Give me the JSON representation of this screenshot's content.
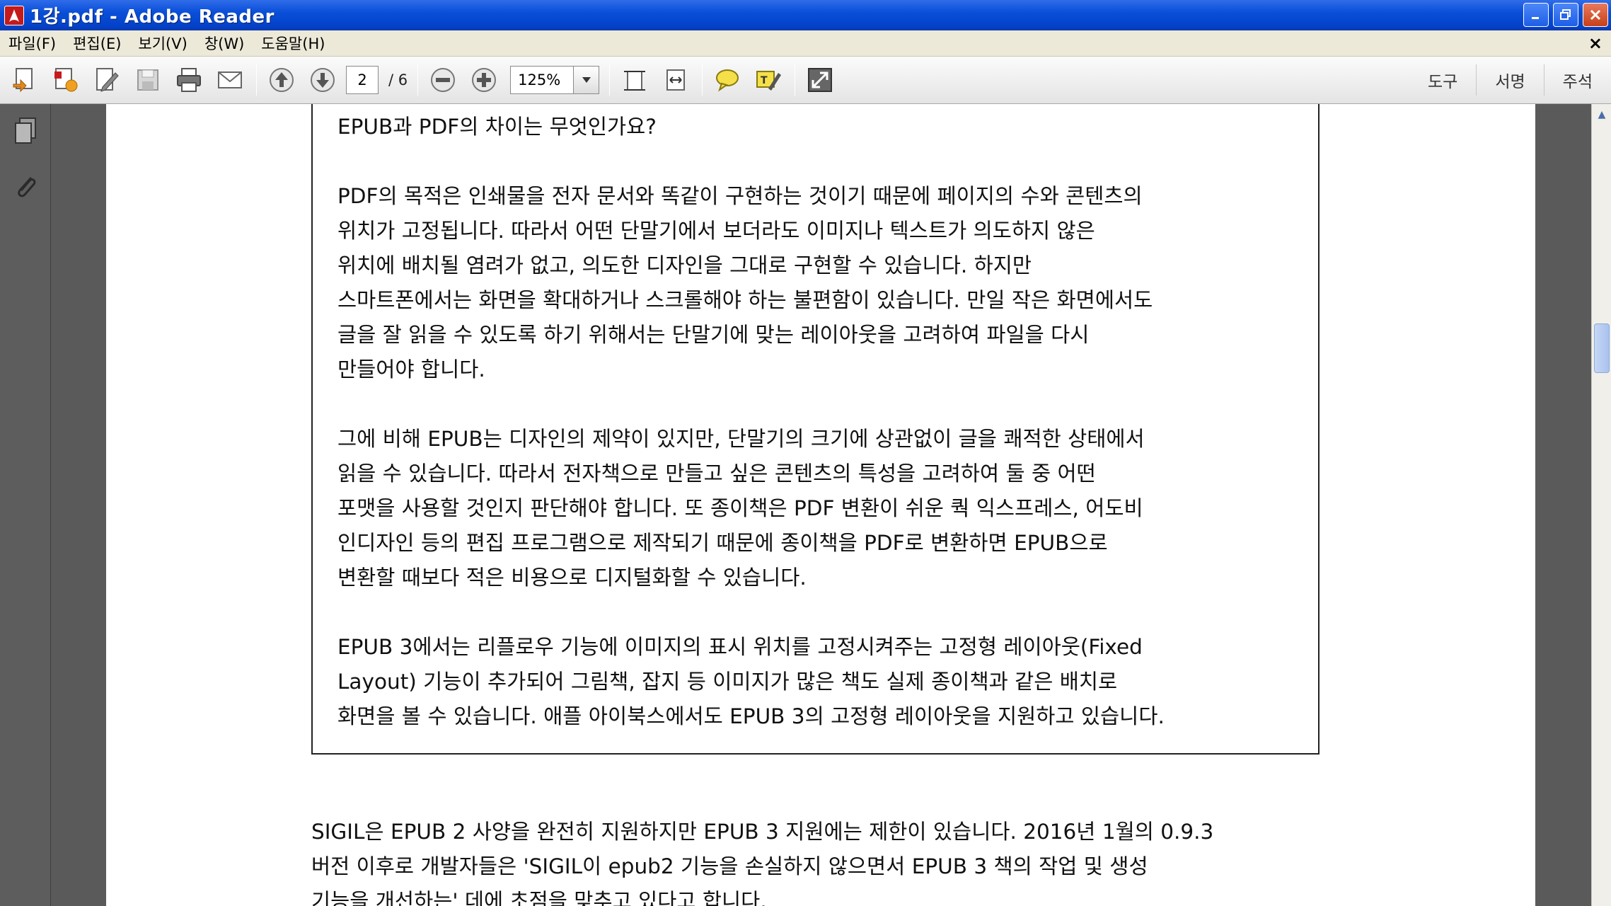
{
  "window": {
    "title": "1강.pdf - Adobe Reader",
    "app_icon_glyph": "★",
    "buttons": {
      "minimize": "_",
      "maximize": "□",
      "close": "×"
    }
  },
  "menu": {
    "items": [
      "파일(F)",
      "편집(E)",
      "보기(V)",
      "창(W)",
      "도움말(H)"
    ],
    "close_glyph": "×"
  },
  "toolbar": {
    "page_current": "2",
    "page_total": "/ 6",
    "zoom": "125%",
    "right_tools": [
      "도구",
      "서명",
      "주석"
    ]
  },
  "document": {
    "boxed_paragraphs": [
      [
        "EPUB과 PDF의 차이는 무엇인가요?"
      ],
      [
        "PDF의 목적은 인쇄물을 전자 문서와 똑같이 구현하는 것이기 때문에 페이지의 수와 콘텐츠의",
        "위치가 고정됩니다. 따라서 어떤 단말기에서 보더라도 이미지나 텍스트가 의도하지 않은",
        "위치에 배치될 염려가 없고, 의도한 디자인을 그대로 구현할 수 있습니다. 하지만",
        "스마트폰에서는 화면을 확대하거나 스크롤해야 하는 불편함이 있습니다. 만일 작은 화면에서도",
        "글을 잘 읽을 수 있도록 하기 위해서는 단말기에 맞는 레이아웃을 고려하여 파일을 다시",
        "만들어야 합니다."
      ],
      [
        "그에 비해 EPUB는 디자인의 제약이 있지만, 단말기의 크기에 상관없이 글을 쾌적한 상태에서",
        "읽을 수 있습니다. 따라서 전자책으로 만들고 싶은 콘텐츠의 특성을 고려하여 둘 중 어떤",
        "포맷을 사용할 것인지 판단해야 합니다. 또 종이책은 PDF 변환이 쉬운 쿽 익스프레스, 어도비",
        "인디자인 등의 편집 프로그램으로 제작되기 때문에 종이책을 PDF로 변환하면 EPUB으로",
        "변환할 때보다 적은 비용으로 디지털화할 수 있습니다."
      ],
      [
        "EPUB 3에서는 리플로우 기능에 이미지의 표시 위치를 고정시켜주는 고정형 레이아웃(Fixed",
        "Layout) 기능이 추가되어 그림책, 잡지 등 이미지가 많은 책도 실제 종이책과 같은 배치로",
        "화면을 볼 수 있습니다. 애플 아이북스에서도 EPUB 3의 고정형 레이아웃을 지원하고 있습니다."
      ]
    ],
    "body_lines": [
      "SIGIL은 EPUB 2 사양을 완전히 지원하지만 EPUB 3 지원에는 제한이 있습니다. 2016년 1월의 0.9.3",
      "버전 이후로 개발자들은 'SIGIL이 epub2 기능을 손실하지 않으면서 EPUB 3 책의 작업 및 생성",
      "기능을 개선하는' 데에 초점을 맞추고 있다고 합니다."
    ]
  },
  "scrollbar": {
    "up_glyph": "▲"
  }
}
